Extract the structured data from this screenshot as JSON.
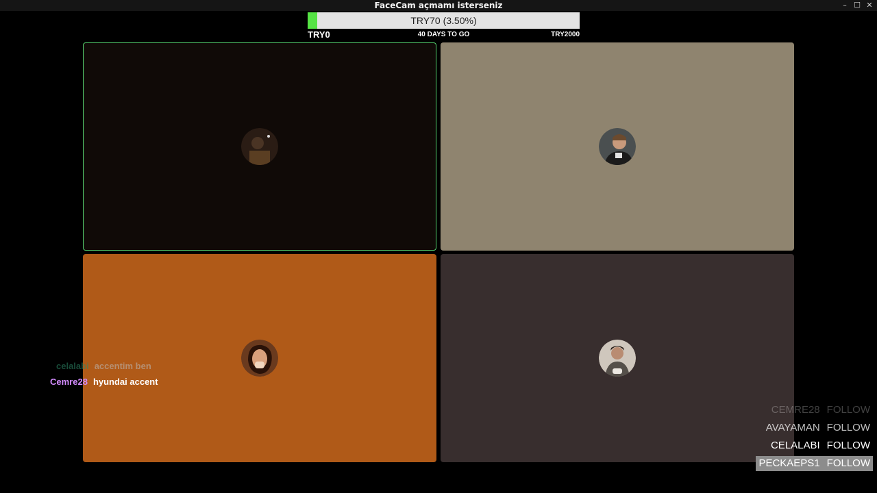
{
  "window": {
    "title": "FaceCam açmamı isterseniz",
    "controls": {
      "minimize": "–",
      "maximize": "☐",
      "close": "✕"
    }
  },
  "goal": {
    "label": "TRY70 (3.50%)",
    "progress_percent": 3.5,
    "min_label": "TRY0",
    "days_label": "40 DAYS TO GO",
    "max_label": "TRY2000",
    "fill_color": "#56e345"
  },
  "tiles": [
    {
      "id": "tile-1",
      "bg": "#100a07",
      "active": true,
      "border_color": "#56d26e"
    },
    {
      "id": "tile-2",
      "bg": "#8f846f",
      "active": false
    },
    {
      "id": "tile-3",
      "bg": "#b05a18",
      "active": false
    },
    {
      "id": "tile-4",
      "bg": "#382e2e",
      "active": false
    }
  ],
  "chat": [
    {
      "user": "celalabi",
      "user_color": "#2e8b6a",
      "message": "accentim ben"
    },
    {
      "user": "Cemre28",
      "user_color": "#d38cff",
      "message": "hyundai accent"
    }
  ],
  "follows": [
    {
      "name": "CEMRE28",
      "action": "FOLLOW"
    },
    {
      "name": "AVAYAMAN",
      "action": "FOLLOW"
    },
    {
      "name": "CELALABI",
      "action": "FOLLOW"
    },
    {
      "name": "PECKAEPS1",
      "action": "FOLLOW"
    }
  ]
}
